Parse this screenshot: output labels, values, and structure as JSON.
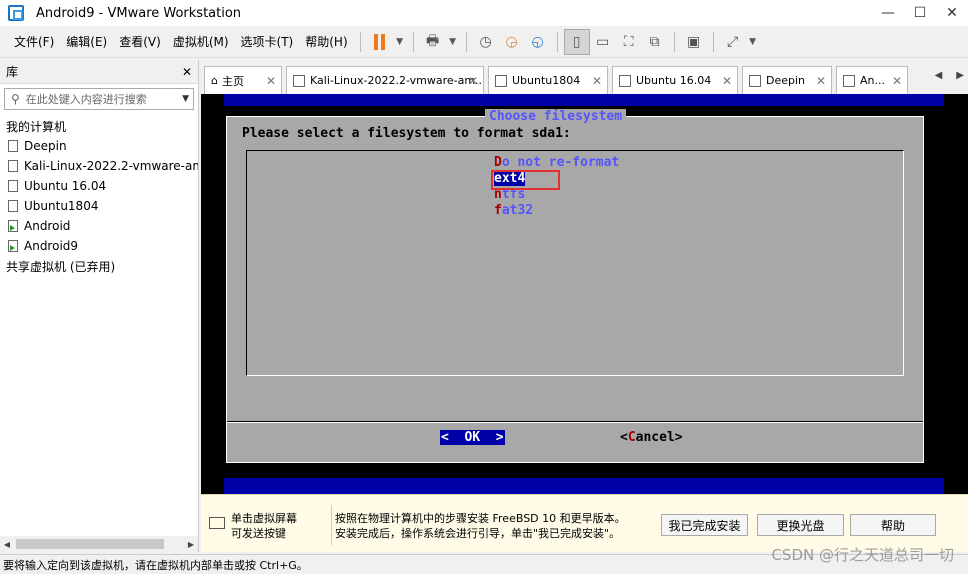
{
  "window": {
    "title": "Android9 - VMware Workstation"
  },
  "menu": [
    "文件(F)",
    "编辑(E)",
    "查看(V)",
    "虚拟机(M)",
    "选项卡(T)",
    "帮助(H)"
  ],
  "sidebar": {
    "title": "库",
    "search_placeholder": "在此处键入内容进行搜索",
    "root": "我的计算机",
    "vms": [
      {
        "name": "Deepin",
        "running": false
      },
      {
        "name": "Kali-Linux-2022.2-vmware-am",
        "running": false
      },
      {
        "name": "Ubuntu 16.04",
        "running": false
      },
      {
        "name": "Ubuntu1804",
        "running": false
      },
      {
        "name": "Android",
        "running": true
      },
      {
        "name": "Android9",
        "running": true
      }
    ],
    "shared": "共享虚拟机 (已弃用)"
  },
  "tabs": [
    "主页",
    "Kali-Linux-2022.2-vmware-am...",
    "Ubuntu1804",
    "Ubuntu 16.04",
    "Deepin",
    "An..."
  ],
  "installer": {
    "title": "Choose filesystem",
    "prompt": "Please select a filesystem to format sda1:",
    "options": [
      {
        "hot": "D",
        "rest": "o not re-format",
        "selected": false
      },
      {
        "hot": "e",
        "rest": "xt4",
        "selected": true
      },
      {
        "hot": "n",
        "rest": "tfs",
        "selected": false
      },
      {
        "hot": "f",
        "rest": "at32",
        "selected": false
      }
    ],
    "ok": "<  OK  >",
    "cancel_pre": "<",
    "cancel_hot": "C",
    "cancel_rest": "ancel>"
  },
  "hint": {
    "left_line1": "单击虚拟屏幕",
    "left_line2": "可发送按键",
    "mid_line1": "按照在物理计算机中的步骤安装 FreeBSD 10 和更早版本。",
    "mid_line2": "安装完成后，操作系统会进行引导，单击\"我已完成安装\"。",
    "btn_done": "我已完成安装",
    "btn_disc": "更换光盘",
    "btn_help": "帮助"
  },
  "status": "要将输入定向到该虚拟机，请在虚拟机内部单击或按 Ctrl+G。",
  "watermark": "CSDN @行之天道总司一切"
}
